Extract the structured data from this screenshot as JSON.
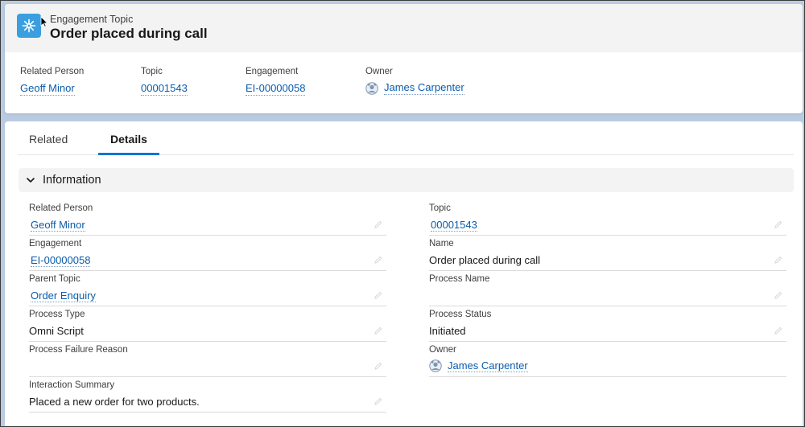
{
  "header": {
    "object_label": "Engagement Topic",
    "record_title": "Order placed during call",
    "icon": "engagement-topic-icon",
    "accent_color": "#3b9fdf"
  },
  "highlights": [
    {
      "label": "Related Person",
      "value": "Geoff Minor"
    },
    {
      "label": "Topic",
      "value": "00001543"
    },
    {
      "label": "Engagement",
      "value": "EI-00000058"
    },
    {
      "label": "Owner",
      "value": "James Carpenter",
      "icon": "user-avatar-icon"
    }
  ],
  "tabs": [
    {
      "label": "Related",
      "active": false
    },
    {
      "label": "Details",
      "active": true
    }
  ],
  "section": {
    "title": "Information",
    "expanded": true
  },
  "fields_left": [
    {
      "label": "Related Person",
      "value": "Geoff Minor",
      "type": "link"
    },
    {
      "label": "Engagement",
      "value": "EI-00000058",
      "type": "link"
    },
    {
      "label": "Parent Topic",
      "value": "Order Enquiry",
      "type": "link"
    },
    {
      "label": "Process Type",
      "value": "Omni Script",
      "type": "text"
    },
    {
      "label": "Process Failure Reason",
      "value": "",
      "type": "text"
    },
    {
      "label": "Interaction Summary",
      "value": "Placed a new order for two products.",
      "type": "text"
    }
  ],
  "fields_right": [
    {
      "label": "Topic",
      "value": "00001543",
      "type": "link"
    },
    {
      "label": "Name",
      "value": "Order placed during call",
      "type": "text"
    },
    {
      "label": "Process Name",
      "value": "",
      "type": "text"
    },
    {
      "label": "Process Status",
      "value": "Initiated",
      "type": "text"
    },
    {
      "label": "Owner",
      "value": "James Carpenter",
      "type": "owner"
    }
  ],
  "colors": {
    "link": "#0b5cab",
    "tab_active": "#0176d3",
    "background": "#b9cbe1"
  }
}
